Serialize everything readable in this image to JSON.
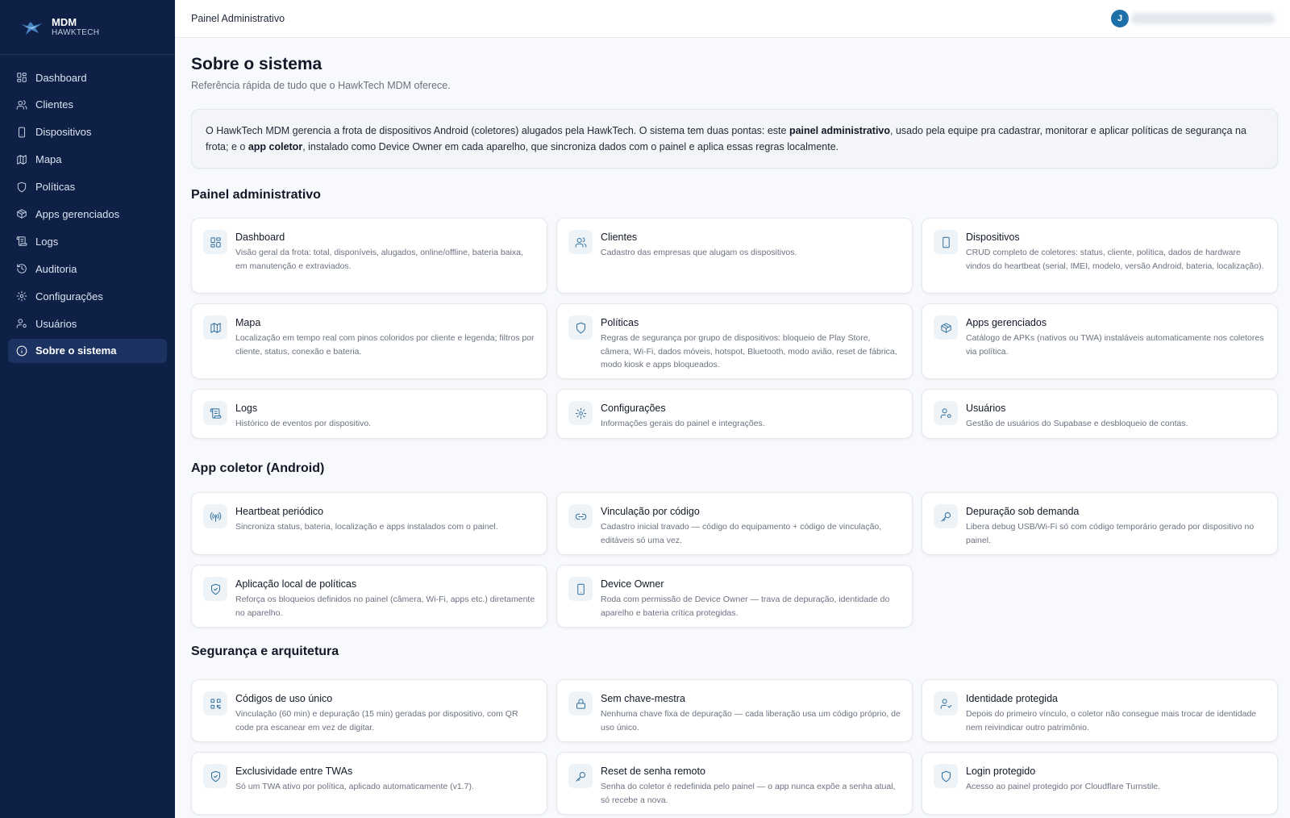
{
  "brand": {
    "name": "MDM",
    "sub": "HAWKTECH"
  },
  "sidebar": {
    "items": [
      {
        "label": "Dashboard",
        "icon": "grid-icon"
      },
      {
        "label": "Clientes",
        "icon": "users-icon"
      },
      {
        "label": "Dispositivos",
        "icon": "smartphone-icon"
      },
      {
        "label": "Mapa",
        "icon": "map-icon"
      },
      {
        "label": "Políticas",
        "icon": "shield-icon"
      },
      {
        "label": "Apps gerenciados",
        "icon": "package-icon"
      },
      {
        "label": "Logs",
        "icon": "scroll-icon"
      },
      {
        "label": "Auditoria",
        "icon": "history-icon"
      },
      {
        "label": "Configurações",
        "icon": "gear-icon"
      },
      {
        "label": "Usuários",
        "icon": "user-cog-icon"
      },
      {
        "label": "Sobre o sistema",
        "icon": "info-icon",
        "active": true
      }
    ]
  },
  "topbar": {
    "title": "Painel Administrativo",
    "avatar_initial": "J"
  },
  "page": {
    "title": "Sobre o sistema",
    "subtitle": "Referência rápida de tudo que o HawkTech MDM oferece.",
    "intro": {
      "p1": "O HawkTech MDM gerencia a frota de dispositivos Android (coletores) alugados pela HawkTech. O sistema tem duas pontas: este ",
      "b1": "painel administrativo",
      "p2": ", usado pela equipe pra cadastrar, monitorar e aplicar políticas de segurança na frota; e o ",
      "b2": "app coletor",
      "p3": ", instalado como Device Owner em cada aparelho, que sincroniza dados com o painel e aplica essas regras localmente."
    }
  },
  "sections": [
    {
      "title": "Painel administrativo",
      "cards": [
        {
          "title": "Dashboard",
          "desc": "Visão geral da frota: total, disponíveis, alugados, online/offline, bateria baixa, em manutenção e extraviados.",
          "icon": "grid-icon"
        },
        {
          "title": "Clientes",
          "desc": "Cadastro das empresas que alugam os dispositivos.",
          "icon": "users-icon"
        },
        {
          "title": "Dispositivos",
          "desc": "CRUD completo de coletores: status, cliente, política, dados de hardware vindos do heartbeat (serial, IMEI, modelo, versão Android, bateria, localização).",
          "icon": "smartphone-icon"
        },
        {
          "title": "Mapa",
          "desc": "Localização em tempo real com pinos coloridos por cliente e legenda; filtros por cliente, status, conexão e bateria.",
          "icon": "map-icon"
        },
        {
          "title": "Políticas",
          "desc": "Regras de segurança por grupo de dispositivos: bloqueio de Play Store, câmera, Wi-Fi, dados móveis, hotspot, Bluetooth, modo avião, reset de fábrica, modo kiosk e apps bloqueados.",
          "icon": "shield-icon"
        },
        {
          "title": "Apps gerenciados",
          "desc": "Catálogo de APKs (nativos ou TWA) instaláveis automaticamente nos coletores via política.",
          "icon": "package-icon"
        },
        {
          "title": "Logs",
          "desc": "Histórico de eventos por dispositivo.",
          "icon": "scroll-icon"
        },
        {
          "title": "Configurações",
          "desc": "Informações gerais do painel e integrações.",
          "icon": "gear-icon"
        },
        {
          "title": "Usuários",
          "desc": "Gestão de usuários do Supabase e desbloqueio de contas.",
          "icon": "user-cog-icon"
        }
      ]
    },
    {
      "title": "App coletor (Android)",
      "cards": [
        {
          "title": "Heartbeat periódico",
          "desc": "Sincroniza status, bateria, localização e apps instalados com o painel.",
          "icon": "radio-icon"
        },
        {
          "title": "Vinculação por código",
          "desc": "Cadastro inicial travado — código do equipamento + código de vinculação, editáveis só uma vez.",
          "icon": "link-icon"
        },
        {
          "title": "Depuração sob demanda",
          "desc": "Libera debug USB/Wi-Fi só com código temporário gerado por dispositivo no painel.",
          "icon": "key-icon"
        },
        {
          "title": "Aplicação local de políticas",
          "desc": "Reforça os bloqueios definidos no painel (câmera, Wi-Fi, apps etc.) diretamente no aparelho.",
          "icon": "shield-check-icon"
        },
        {
          "title": "Device Owner",
          "desc": "Roda com permissão de Device Owner — trava de depuração, identidade do aparelho e bateria crítica protegidas.",
          "icon": "smartphone-icon"
        }
      ]
    },
    {
      "title": "Segurança e arquitetura",
      "cards": [
        {
          "title": "Códigos de uso único",
          "desc": "Vinculação (60 min) e depuração (15 min) geradas por dispositivo, com QR code pra escanear em vez de digitar.",
          "icon": "qr-code-icon"
        },
        {
          "title": "Sem chave-mestra",
          "desc": "Nenhuma chave fixa de depuração — cada liberação usa um código próprio, de uso único.",
          "icon": "lock-icon"
        },
        {
          "title": "Identidade protegida",
          "desc": "Depois do primeiro vínculo, o coletor não consegue mais trocar de identidade nem reivindicar outro patrimônio.",
          "icon": "user-check-icon"
        },
        {
          "title": "Exclusividade entre TWAs",
          "desc": "Só um TWA ativo por política, aplicado automaticamente (v1.7).",
          "icon": "shield-check-icon"
        },
        {
          "title": "Reset de senha remoto",
          "desc": "Senha do coletor é redefinida pelo painel — o app nunca expõe a senha atual, só recebe a nova.",
          "icon": "key-icon"
        },
        {
          "title": "Login protegido",
          "desc": "Acesso ao painel protegido por Cloudflare Turnstile.",
          "icon": "shield-icon"
        }
      ]
    }
  ]
}
